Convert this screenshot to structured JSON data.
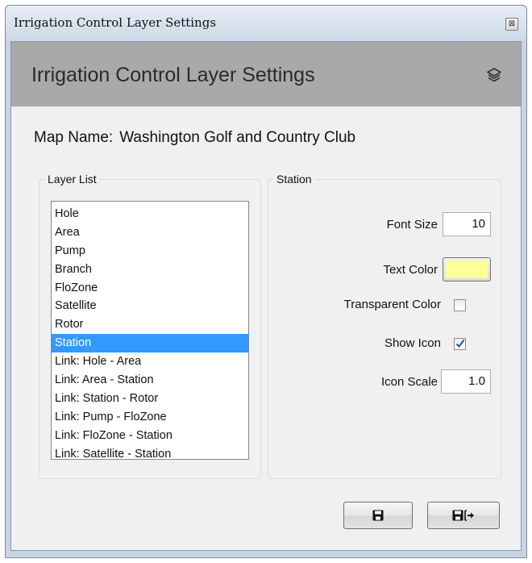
{
  "window": {
    "title": "Irrigation Control Layer Settings",
    "close_glyph": "⊠"
  },
  "header": {
    "title": "Irrigation Control Layer Settings",
    "icon": "layers-icon",
    "background": "#a9a9a9"
  },
  "map": {
    "label": "Map Name:",
    "value": "Washington Golf and Country Club"
  },
  "layer_list": {
    "title": "Layer List",
    "items": [
      "Hole",
      "Area",
      "Pump",
      "Branch",
      "FloZone",
      "Satellite",
      "Rotor",
      "Station",
      "Link: Hole - Area",
      "Link: Area - Station",
      "Link: Station - Rotor",
      "Link: Pump - FloZone",
      "Link: FloZone - Station",
      "Link: Satellite - Station"
    ],
    "selected": "Station",
    "selection_color": "#3399ff"
  },
  "station": {
    "title": "Station",
    "font_size_label": "Font Size",
    "font_size_value": "10",
    "text_color_label": "Text Color",
    "text_color_value": "#ffff99",
    "transparent_color_label": "Transparent Color",
    "transparent_color_checked": false,
    "show_icon_label": "Show Icon",
    "show_icon_checked": true,
    "icon_scale_label": "Icon Scale",
    "icon_scale_value": "1.0"
  },
  "buttons": {
    "save_icon": "save-icon",
    "save_exit_icon": "save-and-exit-icon"
  }
}
